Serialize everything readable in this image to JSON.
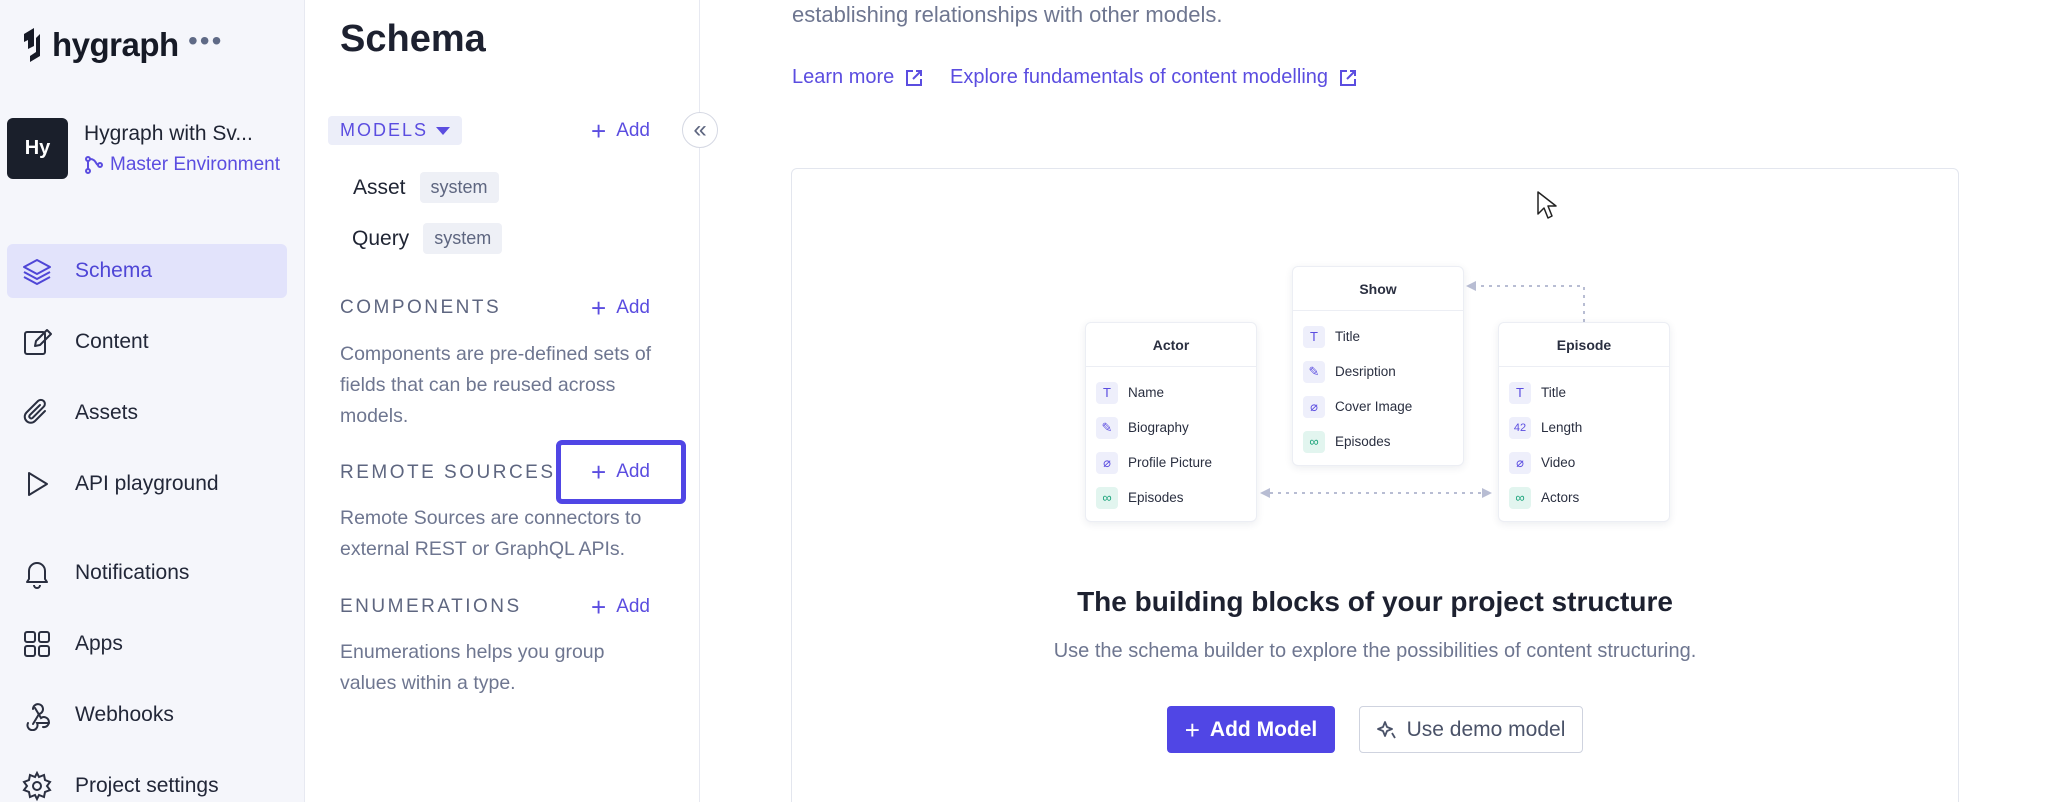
{
  "brand": {
    "logo_text": "hygraph",
    "more": "•••"
  },
  "project": {
    "avatar": "Hy",
    "name": "Hygraph with Sv...",
    "environment": "Master Environment"
  },
  "nav": {
    "items": [
      {
        "label": "Schema",
        "icon": "layers-icon",
        "active": true
      },
      {
        "label": "Content",
        "icon": "edit-icon"
      },
      {
        "label": "Assets",
        "icon": "paperclip-icon"
      },
      {
        "label": "API playground",
        "icon": "play-icon"
      },
      {
        "label": "Notifications",
        "icon": "bell-icon"
      },
      {
        "label": "Apps",
        "icon": "grid-icon"
      },
      {
        "label": "Webhooks",
        "icon": "webhook-icon"
      },
      {
        "label": "Project settings",
        "icon": "gear-icon"
      }
    ]
  },
  "schema_panel": {
    "title": "Schema",
    "models_label": "MODELS",
    "add_label": "Add",
    "system_models": [
      {
        "name": "Asset",
        "badge": "system"
      },
      {
        "name": "Query",
        "badge": "system"
      }
    ],
    "components": {
      "heading": "COMPONENTS",
      "description": "Components are pre-defined sets of fields that can be reused across models."
    },
    "remote_sources": {
      "heading": "REMOTE SOURCES",
      "description": "Remote Sources are connectors to external REST or GraphQL APIs."
    },
    "enumerations": {
      "heading": "ENUMERATIONS",
      "description": "Enumerations helps you group values within a type."
    }
  },
  "main": {
    "intro_text": "establishing relationships with other models.",
    "learn_more": "Learn more",
    "fundamentals": "Explore fundamentals of content modelling",
    "illustration": {
      "actor": {
        "title": "Actor",
        "fields": [
          "Name",
          "Biography",
          "Profile Picture",
          "Episodes"
        ]
      },
      "show": {
        "title": "Show",
        "fields": [
          "Title",
          "Desription",
          "Cover Image",
          "Episodes"
        ]
      },
      "episode": {
        "title": "Episode",
        "fields": [
          "Title",
          "Length",
          "Video",
          "Actors"
        ],
        "number_glyph": "42"
      },
      "text_glyph": "T"
    },
    "headline": "The building blocks of your project structure",
    "subline": "Use the schema builder to explore the possibilities of content structuring.",
    "add_model": "Add Model",
    "demo_model": "Use demo model"
  },
  "colors": {
    "accent": "#5046e5",
    "nav_active_bg": "#e2e3fb",
    "reference_green": "#1aa37a"
  }
}
